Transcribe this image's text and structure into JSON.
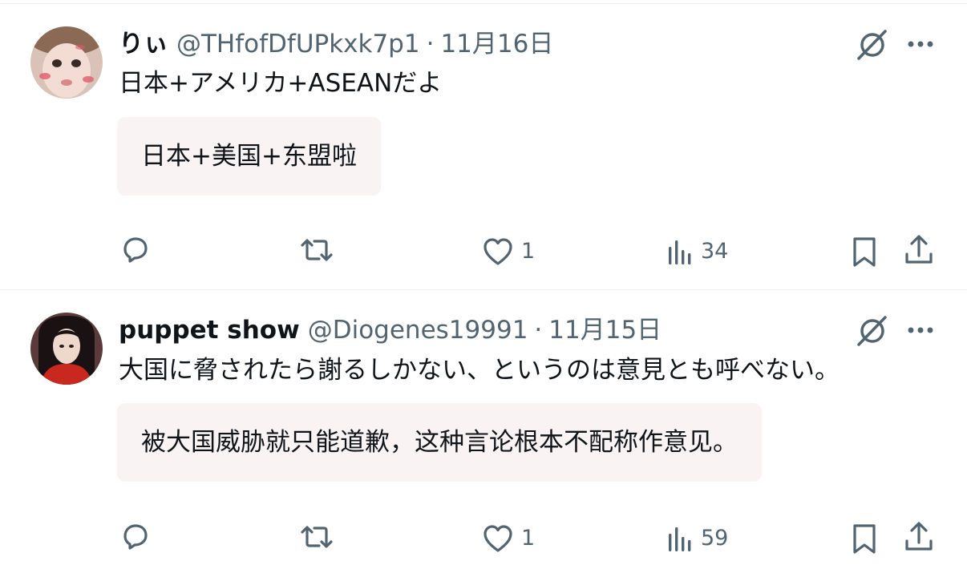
{
  "posts": [
    {
      "name": "りぃ",
      "handle": "@THfofDfUPkxk7p1",
      "separator": "·",
      "time": "11月16日",
      "text": "日本+アメリカ+ASEANだよ",
      "translation": "日本+美国+东盟啦",
      "likes": "1",
      "views": "34"
    },
    {
      "name": "puppet show",
      "handle": "@Diogenes19991",
      "separator": "·",
      "time": "11月15日",
      "text": "大国に脅されたら謝るしかない、というのは意見とも呼べない。",
      "translation": "被大国威胁就只能道歉，这种言论根本不配称作意见。",
      "likes": "1",
      "views": "59"
    }
  ],
  "icons": {
    "reply": "speech-bubble-icon",
    "repost": "repost-arrows-icon",
    "like": "heart-icon",
    "views": "bar-chart-icon",
    "bookmark": "bookmark-icon",
    "share": "share-upload-icon",
    "grok": "grok-slash-circle-icon",
    "more": "ellipsis-icon"
  },
  "colors": {
    "text": "#0f1419",
    "secondary": "#536471",
    "translation_bg": "#f9f3f3",
    "divider": "#eff3f4"
  }
}
